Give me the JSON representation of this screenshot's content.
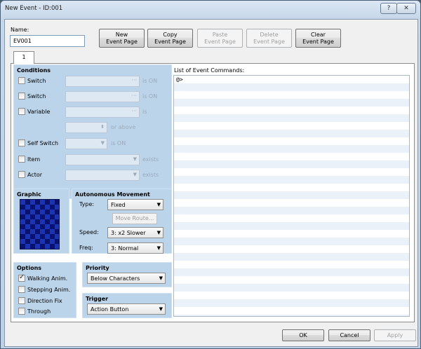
{
  "window": {
    "title": "New Event - ID:001",
    "help_glyph": "?",
    "close_glyph": "✕"
  },
  "name": {
    "label": "Name:",
    "value": "EV001"
  },
  "page_buttons": [
    {
      "line1": "New",
      "line2": "Event Page",
      "enabled": true
    },
    {
      "line1": "Copy",
      "line2": "Event Page",
      "enabled": true
    },
    {
      "line1": "Paste",
      "line2": "Event Page",
      "enabled": false
    },
    {
      "line1": "Delete",
      "line2": "Event Page",
      "enabled": false
    },
    {
      "line1": "Clear",
      "line2": "Event Page",
      "enabled": true
    }
  ],
  "tab": {
    "label": "1"
  },
  "conditions": {
    "title": "Conditions",
    "switch1": {
      "label": "Switch",
      "suffix": "is ON"
    },
    "switch2": {
      "label": "Switch",
      "suffix": "is ON"
    },
    "variable": {
      "label": "Variable",
      "suffix": "is",
      "suffix2": "or above"
    },
    "self_switch": {
      "label": "Self Switch",
      "suffix": "is ON"
    },
    "item": {
      "label": "Item",
      "suffix": "exists"
    },
    "actor": {
      "label": "Actor",
      "suffix": "exists"
    }
  },
  "graphic": {
    "title": "Graphic"
  },
  "autonomous": {
    "title": "Autonomous Movement",
    "type_label": "Type:",
    "type_value": "Fixed",
    "move_route_label": "Move Route...",
    "speed_label": "Speed:",
    "speed_value": "3: x2 Slower",
    "freq_label": "Freq:",
    "freq_value": "3: Normal"
  },
  "options": {
    "title": "Options",
    "items": [
      {
        "label": "Walking Anim.",
        "checked": true
      },
      {
        "label": "Stepping Anim.",
        "checked": false
      },
      {
        "label": "Direction Fix",
        "checked": false
      },
      {
        "label": "Through",
        "checked": false
      }
    ]
  },
  "priority": {
    "title": "Priority",
    "value": "Below Characters"
  },
  "trigger": {
    "title": "Trigger",
    "value": "Action Button"
  },
  "commands": {
    "label": "List of Event Commands:",
    "items": [
      "@>"
    ]
  },
  "footer": {
    "ok": "OK",
    "cancel": "Cancel",
    "apply": "Apply"
  },
  "colors": {
    "panel": "#bcd4ea",
    "graphic_dark": "#0a1270",
    "graphic_light": "#1a34b4"
  }
}
